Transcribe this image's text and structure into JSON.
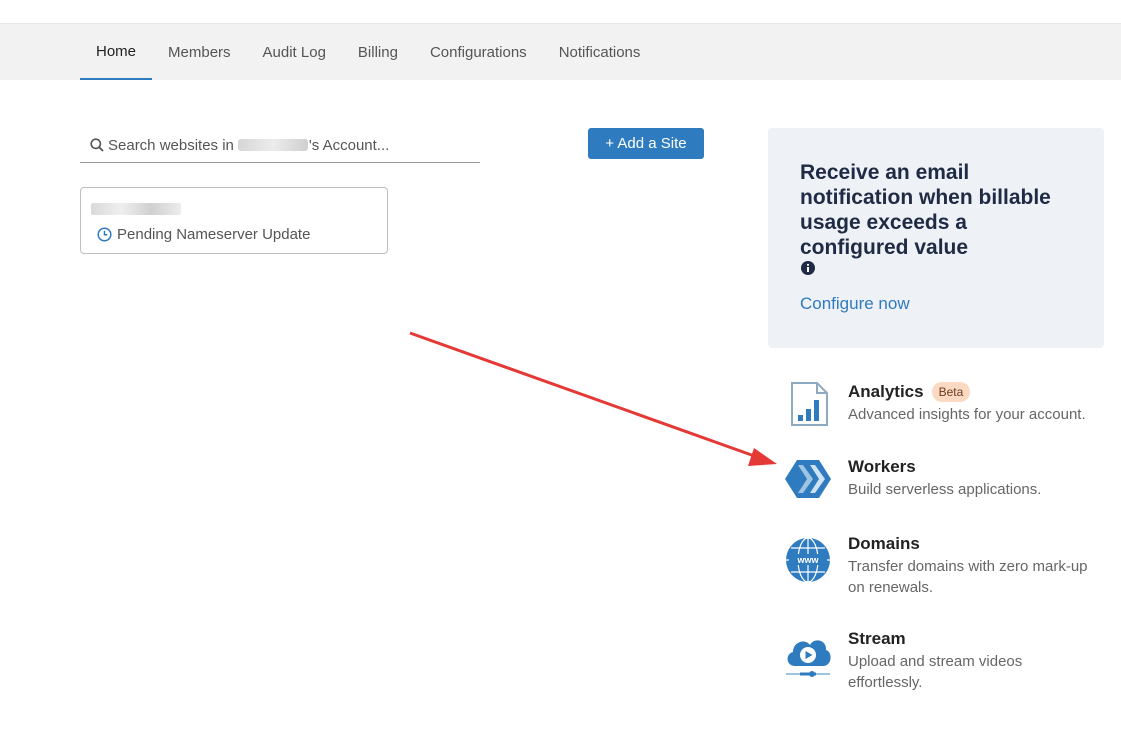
{
  "nav": {
    "tabs": [
      {
        "label": "Home",
        "active": true
      },
      {
        "label": "Members"
      },
      {
        "label": "Audit Log"
      },
      {
        "label": "Billing"
      },
      {
        "label": "Configurations"
      },
      {
        "label": "Notifications"
      }
    ]
  },
  "search": {
    "prefix": "Search websites in",
    "suffix": "'s Account..."
  },
  "add_site": {
    "label": "+ Add a Site"
  },
  "site": {
    "status": "Pending Nameserver Update"
  },
  "promo": {
    "title": "Receive an email notification when billable usage exceeds a configured value",
    "link": "Configure now"
  },
  "products": [
    {
      "name": "Analytics",
      "badge": "Beta",
      "desc": "Advanced insights for your account."
    },
    {
      "name": "Workers",
      "desc": "Build serverless applications."
    },
    {
      "name": "Domains",
      "desc": "Transfer domains with zero mark-up on renewals."
    },
    {
      "name": "Stream",
      "desc": "Upload and stream videos effortlessly."
    }
  ],
  "colors": {
    "accent": "#2f7bbf",
    "annotation_arrow": "#e53935"
  }
}
